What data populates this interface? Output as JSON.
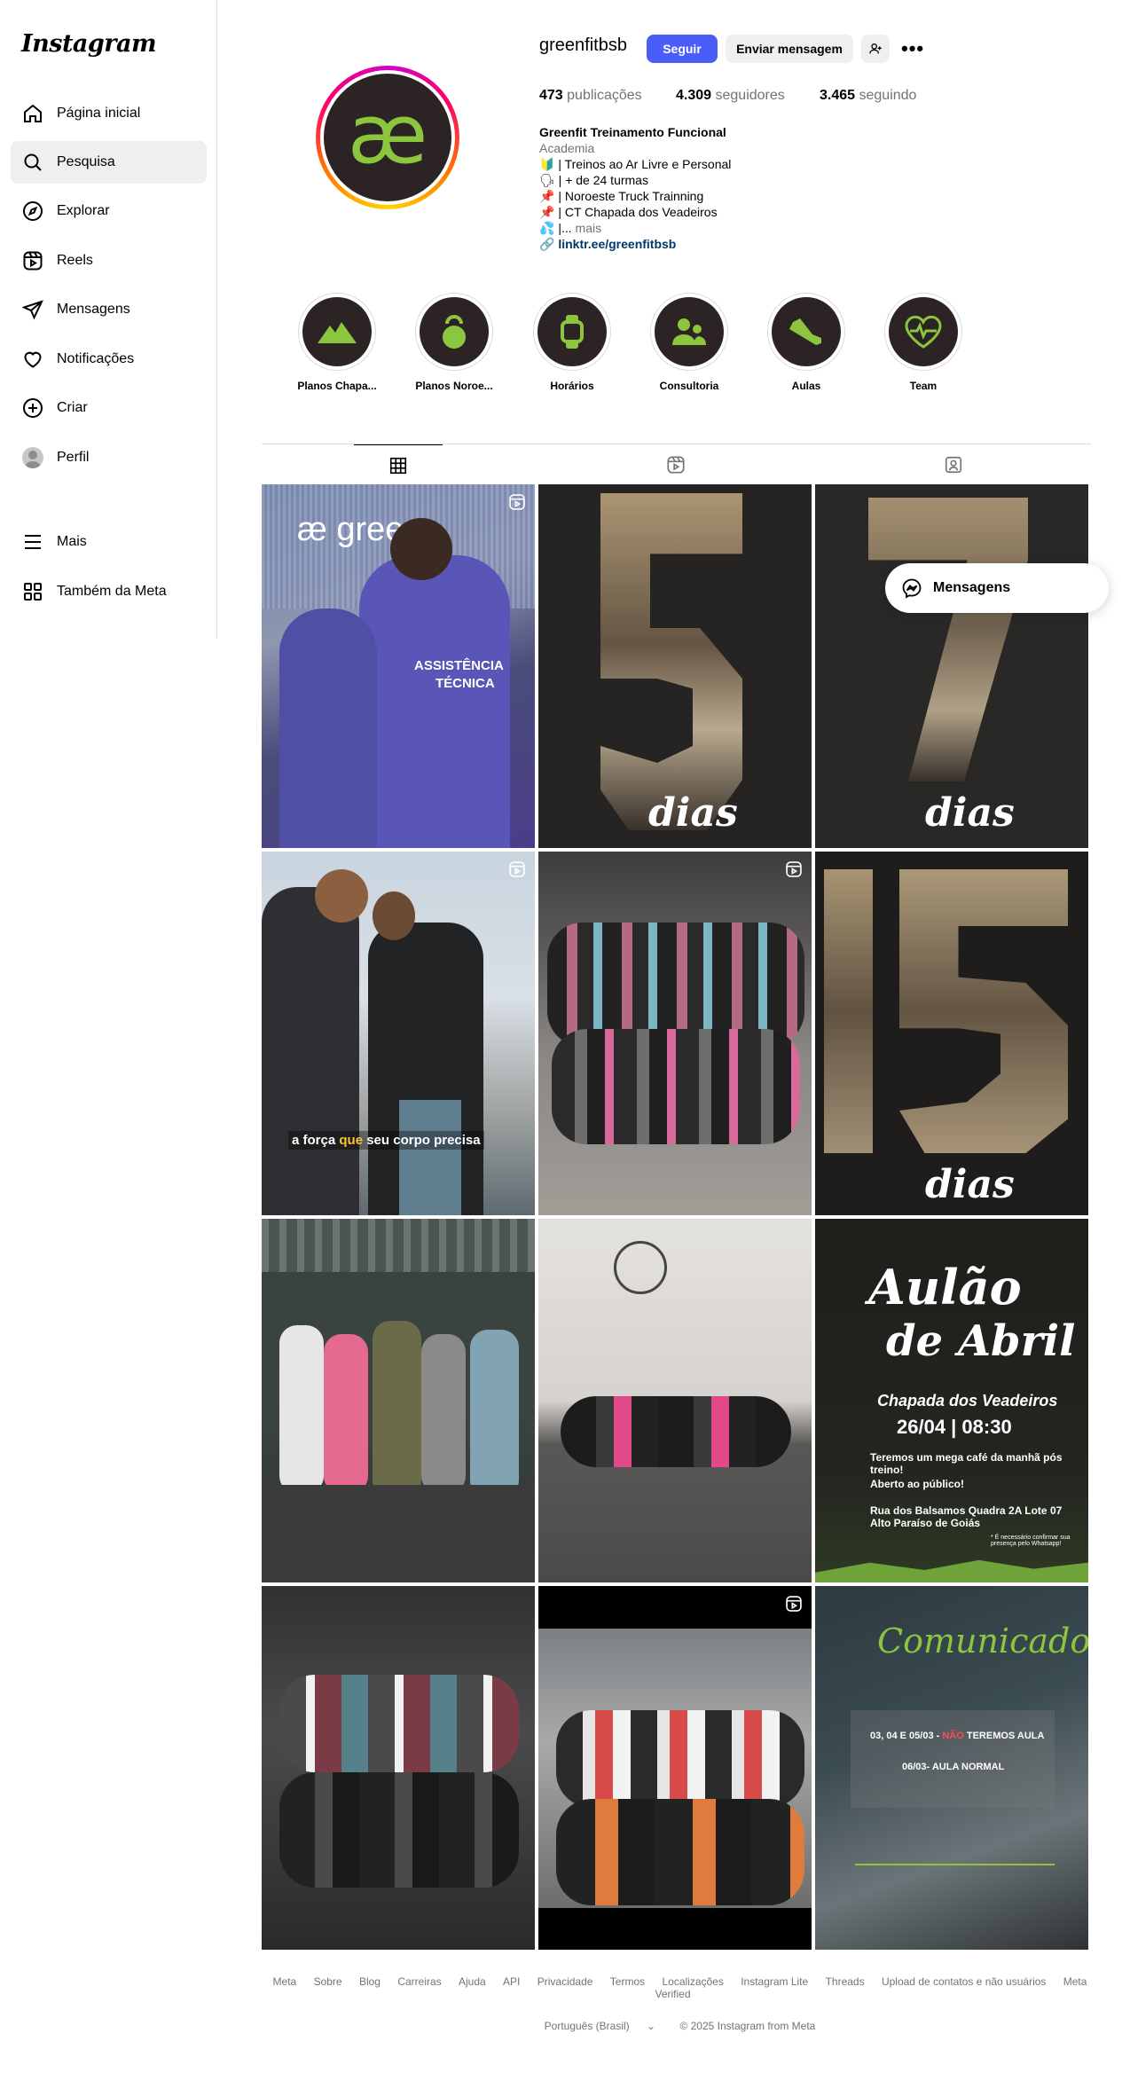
{
  "app": {
    "logo": "Instagram"
  },
  "sidebar": {
    "items": [
      {
        "label": "Página inicial",
        "icon": "home-icon"
      },
      {
        "label": "Pesquisa",
        "icon": "search-icon",
        "active": true
      },
      {
        "label": "Explorar",
        "icon": "compass-icon"
      },
      {
        "label": "Reels",
        "icon": "reels-icon"
      },
      {
        "label": "Mensagens",
        "icon": "send-icon"
      },
      {
        "label": "Notificações",
        "icon": "heart-icon"
      },
      {
        "label": "Criar",
        "icon": "plus-square-icon"
      },
      {
        "label": "Perfil",
        "icon": "avatar"
      },
      {
        "label": "Mais",
        "icon": "menu-icon"
      },
      {
        "label": "Também da Meta",
        "icon": "apps-icon"
      }
    ]
  },
  "profile": {
    "username": "greenfitbsb",
    "follow_label": "Seguir",
    "message_label": "Enviar mensagem",
    "avatar_glyph": "æ",
    "stats": {
      "posts_count": "473",
      "posts_label": "publicações",
      "followers_count": "4.309",
      "followers_label": "seguidores",
      "following_count": "3.465",
      "following_label": "seguindo"
    },
    "bio": {
      "name": "Greenfit Treinamento Funcional",
      "category": "Academia",
      "lines": [
        "🔰 | Treinos ao Ar Livre e Personal",
        "🗣 | + de 24 turmas",
        "📌 | Noroeste Truck Trainning",
        "📌 | CT Chapada dos Veadeiros"
      ],
      "truncated": "💦 |...",
      "more_label": "mais",
      "link": "linktr.ee/greenfitbsb"
    }
  },
  "highlights": [
    {
      "label": "Planos Chapa...",
      "icon": "mountain-icon"
    },
    {
      "label": "Planos Noroe...",
      "icon": "kettlebell-icon"
    },
    {
      "label": "Horários",
      "icon": "watch-icon"
    },
    {
      "label": "Consultoria",
      "icon": "users-icon"
    },
    {
      "label": "Aulas",
      "icon": "sneaker-icon"
    },
    {
      "label": "Team",
      "icon": "heartbeat-icon"
    }
  ],
  "tabs": [
    {
      "name": "posts",
      "icon": "grid-icon",
      "active": true
    },
    {
      "name": "reels",
      "icon": "reels-icon"
    },
    {
      "name": "tagged",
      "icon": "tagged-icon"
    }
  ],
  "posts": {
    "p1": {
      "brand": "æ green",
      "shirt_line1": "ASSISTÊNCIA",
      "shirt_line2": "TÉCNICA"
    },
    "p2": {
      "big": "5",
      "caption": "dias"
    },
    "p3": {
      "big": "7",
      "caption": "dias"
    },
    "p4": {
      "caption_a": "a força",
      "caption_b": "que",
      "caption_c": "seu corpo precisa"
    },
    "p6": {
      "big": "15",
      "caption": "dias"
    },
    "p9": {
      "title1": "Aulão",
      "title2": "de Abril",
      "place": "Chapada dos Veadeiros",
      "date": "26/04 | 08:30",
      "info1": "Teremos um mega café da manhã pós treino!",
      "info2": "Aberto ao público!",
      "info3a": "Rua dos Balsamos Quadra 2A Lote 07",
      "info3b": "Alto Paraíso de Goiás",
      "note": "* É necessário confirmar sua presença pelo Whatsapp!"
    },
    "p12": {
      "title": "Comunicado",
      "line1a": "03, 04 E 05/03 -",
      "line1b": "NÃO",
      "line1c": "TEREMOS AULA",
      "line2": "06/03- AULA NORMAL"
    }
  },
  "messages_pill": {
    "label": "Mensagens"
  },
  "footer": {
    "links": [
      "Meta",
      "Sobre",
      "Blog",
      "Carreiras",
      "Ajuda",
      "API",
      "Privacidade",
      "Termos",
      "Localizações",
      "Instagram Lite",
      "Threads",
      "Upload de contatos e não usuários",
      "Meta Verified"
    ],
    "language": "Português (Brasil)",
    "copyright": "© 2025 Instagram from Meta"
  }
}
